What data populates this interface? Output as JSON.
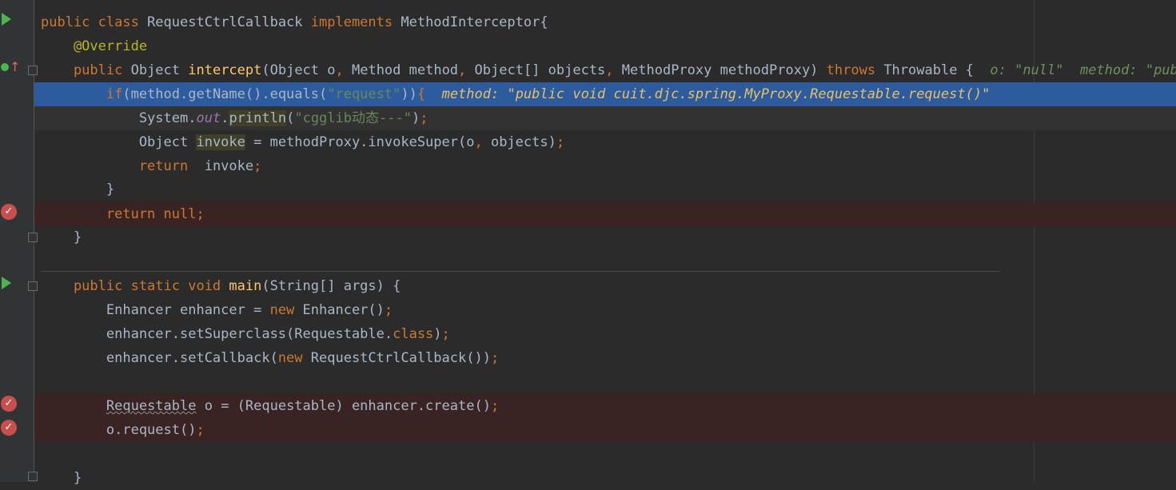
{
  "editor": {
    "lines": [
      {
        "tokens": [
          [
            "kw",
            "public class "
          ],
          [
            "t",
            "RequestCtrlCallback "
          ],
          [
            "kw",
            "implements "
          ],
          [
            "t",
            "MethodInterceptor{"
          ]
        ]
      },
      {
        "tokens": [
          [
            "ann",
            "    @Override"
          ]
        ]
      },
      {
        "tokens": [
          [
            "kw",
            "    public "
          ],
          [
            "t",
            "Object "
          ],
          [
            "fn",
            "intercept"
          ],
          [
            "t",
            "(Object o"
          ],
          [
            "kw",
            ", "
          ],
          [
            "t",
            "Method method"
          ],
          [
            "kw",
            ", "
          ],
          [
            "t",
            "Object[] objects"
          ],
          [
            "kw",
            ", "
          ],
          [
            "t",
            "MethodProxy methodProxy) "
          ],
          [
            "kw",
            "throws "
          ],
          [
            "t",
            "Throwable {  "
          ],
          [
            "hint-gray",
            "o: \"null\"  method: \"public"
          ]
        ]
      },
      {
        "tokens": [
          [
            "kw",
            "        if"
          ],
          [
            "t",
            "(method.getName().equals("
          ],
          [
            "str",
            "\"request\""
          ],
          [
            "t",
            "))"
          ],
          [
            "kw",
            "{"
          ],
          [
            "t",
            "  "
          ],
          [
            "hint",
            "method: \"public void cuit.djc.spring.MyProxy.Requestable.request()\""
          ]
        ]
      },
      {
        "tokens": [
          [
            "t",
            "            System."
          ],
          [
            "fld",
            "out"
          ],
          [
            "t",
            "."
          ],
          [
            "usage",
            "println"
          ],
          [
            "t",
            "("
          ],
          [
            "str",
            "\"cgglib动态---\""
          ],
          [
            "t",
            ")"
          ],
          [
            "kw",
            ";"
          ]
        ]
      },
      {
        "tokens": [
          [
            "t",
            "            Object "
          ],
          [
            "usage",
            "invoke"
          ],
          [
            "t",
            " = methodProxy.invokeSuper(o"
          ],
          [
            "kw",
            ", "
          ],
          [
            "t",
            "objects)"
          ],
          [
            "kw",
            ";"
          ]
        ]
      },
      {
        "tokens": [
          [
            "kw",
            "            return  "
          ],
          [
            "t",
            "invoke"
          ],
          [
            "kw",
            ";"
          ]
        ]
      },
      {
        "tokens": [
          [
            "t",
            "        }"
          ]
        ]
      },
      {
        "tokens": [
          [
            "kw",
            "        return null;"
          ]
        ]
      },
      {
        "tokens": [
          [
            "t",
            "    }"
          ]
        ]
      },
      {
        "tokens": []
      },
      {
        "tokens": [
          [
            "kw",
            "    public static void "
          ],
          [
            "fn",
            "main"
          ],
          [
            "t",
            "(String[] args) {"
          ]
        ]
      },
      {
        "tokens": [
          [
            "t",
            "        Enhancer enhancer = "
          ],
          [
            "kw",
            "new "
          ],
          [
            "t",
            "Enhancer()"
          ],
          [
            "kw",
            ";"
          ]
        ]
      },
      {
        "tokens": [
          [
            "t",
            "        enhancer.setSuperclass(Requestable."
          ],
          [
            "kw",
            "class"
          ],
          [
            "t",
            ")"
          ],
          [
            "kw",
            ";"
          ]
        ]
      },
      {
        "tokens": [
          [
            "t",
            "        enhancer.setCallback("
          ],
          [
            "kw",
            "new "
          ],
          [
            "t",
            "RequestCtrlCallback())"
          ],
          [
            "kw",
            ";"
          ]
        ]
      },
      {
        "tokens": []
      },
      {
        "tokens": [
          [
            "t",
            "        "
          ],
          [
            "squig",
            "Requestable"
          ],
          [
            "t",
            " o = (Requestable) enhancer.create()"
          ],
          [
            "kw",
            ";"
          ]
        ]
      },
      {
        "tokens": [
          [
            "t",
            "        o.request()"
          ],
          [
            "kw",
            ";"
          ]
        ]
      },
      {
        "tokens": []
      },
      {
        "tokens": [
          [
            "t",
            "    }"
          ]
        ]
      }
    ]
  },
  "gutter": {
    "icons": [
      "run-icon",
      "override-icon",
      "fold-icon",
      "breakpoint-icon",
      "fold-icon",
      "run-icon",
      "fold-icon",
      "breakpoint-icon",
      "breakpoint-icon",
      "fold-icon"
    ]
  },
  "colors": {
    "background": "#2b2b2b",
    "execution_line": "#2d5c9e",
    "breakpoint_line": "#3a2323",
    "keyword": "#cc7832",
    "method": "#ffc66d",
    "string": "#6a8759",
    "annotation": "#bbb529",
    "debug_hint": "#e8bf6a"
  }
}
